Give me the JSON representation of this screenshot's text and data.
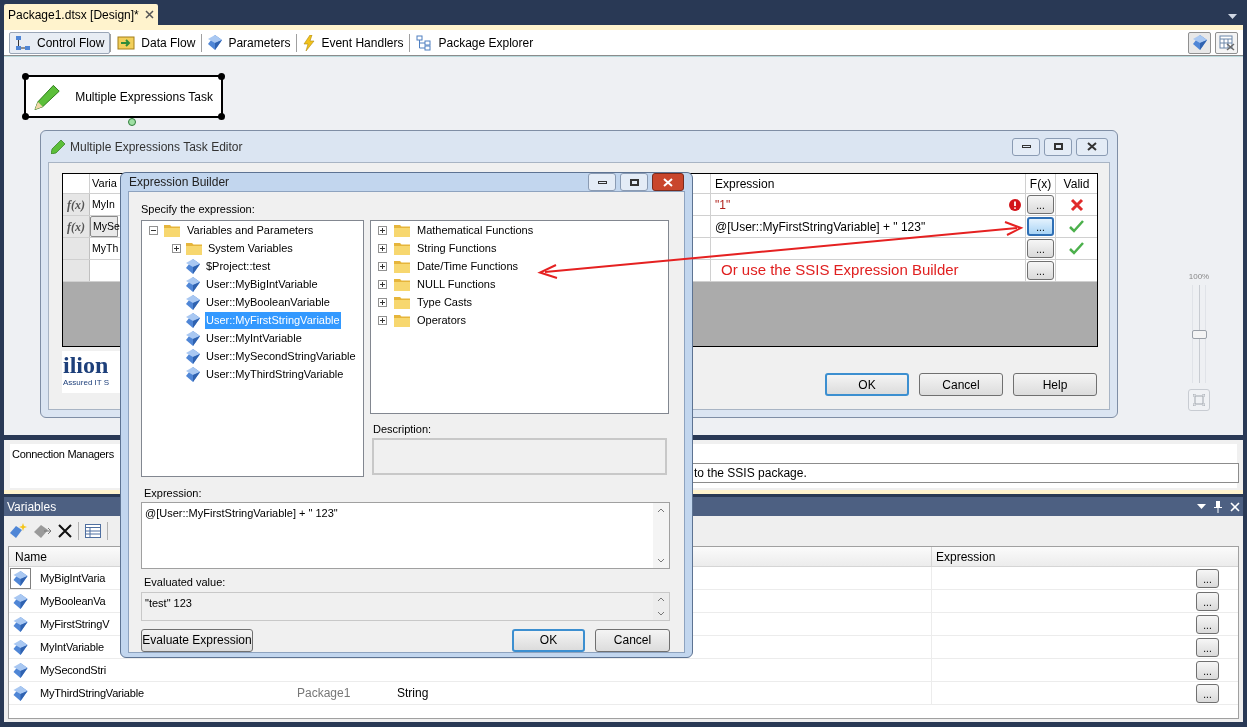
{
  "document_tab": {
    "title": "Package1.dtsx [Design]*"
  },
  "designer_tabs": [
    {
      "label": "Control Flow",
      "kind": "flow",
      "selected": true
    },
    {
      "label": "Data Flow",
      "kind": "data",
      "selected": false
    },
    {
      "label": "Parameters",
      "kind": "parameters",
      "selected": false
    },
    {
      "label": "Event Handlers",
      "kind": "events",
      "selected": false
    },
    {
      "label": "Package Explorer",
      "kind": "explorer",
      "selected": false
    }
  ],
  "task": {
    "label": "Multiple Expressions Task"
  },
  "task_editor": {
    "title": "Multiple Expressions Task Editor",
    "columns": [
      "Varia",
      "Expression",
      "F(x)",
      "Valid"
    ],
    "rows": [
      {
        "marker": "f(x)",
        "variable": "MyIn",
        "expression": "\"1\"",
        "error": true,
        "valid": false,
        "button": "...",
        "selected": false
      },
      {
        "marker": "f(x)",
        "variable": "MySe",
        "expression": "@[User::MyFirstStringVariable] + \" 123\"",
        "error": false,
        "valid": true,
        "button": "...",
        "selected": true
      },
      {
        "variable": "MyTh",
        "error": false,
        "valid": true,
        "button": "...",
        "selected": false
      },
      {
        "note": "Or use the SSIS Expression Builder",
        "error": false,
        "button": "...",
        "selected": false
      }
    ],
    "logo": {
      "name": "ilion",
      "tagline": "Assured IT S"
    },
    "buttons": [
      {
        "label": "OK",
        "default": true
      },
      {
        "label": "Cancel",
        "default": false
      },
      {
        "label": "Help",
        "default": false
      }
    ]
  },
  "expression_builder": {
    "title": "Expression Builder",
    "prompt": "Specify the expression:",
    "variables_tree": [
      {
        "label": "Variables and Parameters",
        "kind": "folder",
        "expanded": true,
        "selected": false,
        "children": [
          {
            "label": "System Variables",
            "kind": "folder",
            "expanded": false,
            "selected": false
          },
          {
            "label": "$Project::test",
            "kind": "variable",
            "selected": false
          },
          {
            "label": "User::MyBigIntVariable",
            "kind": "variable",
            "selected": false
          },
          {
            "label": "User::MyBooleanVariable",
            "kind": "variable",
            "selected": false
          },
          {
            "label": "User::MyFirstStringVariable",
            "kind": "variable",
            "selected": true
          },
          {
            "label": "User::MyIntVariable",
            "kind": "variable",
            "selected": false
          },
          {
            "label": "User::MySecondStringVariable",
            "kind": "variable",
            "selected": false
          },
          {
            "label": "User::MyThirdStringVariable",
            "kind": "variable",
            "selected": false
          }
        ]
      }
    ],
    "functions_tree": [
      {
        "label": "Mathematical Functions",
        "expanded": false
      },
      {
        "label": "String Functions",
        "expanded": false
      },
      {
        "label": "Date/Time Functions",
        "expanded": false
      },
      {
        "label": "NULL Functions",
        "expanded": false
      },
      {
        "label": "Type Casts",
        "expanded": false
      },
      {
        "label": "Operators",
        "expanded": false
      }
    ],
    "description_label": "Description:",
    "expression_label": "Expression:",
    "expression": "@[User::MyFirstStringVariable] + \" 123\"",
    "evaluated_label": "Evaluated value:",
    "evaluated_value": "\"test\" 123",
    "buttons": [
      {
        "label": "Evaluate Expression",
        "default": false
      },
      {
        "label": "OK",
        "default": true
      },
      {
        "label": "Cancel",
        "default": false
      }
    ]
  },
  "connection_managers": {
    "label": "Connection Managers",
    "hint": "to the SSIS package."
  },
  "zoom": {
    "label": "100%",
    "level": 0.5
  },
  "variables_panel": {
    "title": "Variables",
    "columns": [
      "Name",
      "Expression"
    ],
    "rows": [
      {
        "name": "MyBigIntVaria",
        "button": "...",
        "focused": true
      },
      {
        "name": "MyBooleanVa",
        "button": "...",
        "focused": false
      },
      {
        "name": "MyFirstStringV",
        "button": "...",
        "focused": false
      },
      {
        "name": "MyIntVariable",
        "button": "...",
        "focused": false
      },
      {
        "name": "MySecondStri",
        "button": "...",
        "focused": false
      },
      {
        "name": "MyThirdStringVariable",
        "scope": "Package1",
        "data_type": "String",
        "button": "...",
        "focused": false
      }
    ]
  }
}
